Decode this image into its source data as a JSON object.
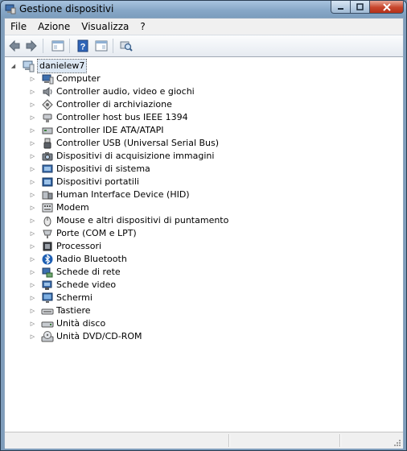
{
  "window": {
    "title": "Gestione dispositivi"
  },
  "menu": [
    "File",
    "Azione",
    "Visualizza",
    "?"
  ],
  "toolbar": {
    "buttons": [
      "back-arrow-icon",
      "forward-arrow-icon",
      "console-tree-icon",
      "help-icon",
      "properties-icon",
      "scan-hardware-icon"
    ]
  },
  "tree": {
    "root": "danielew7",
    "items": [
      {
        "label": "Computer",
        "icon": "computer-icon"
      },
      {
        "label": "Controller audio, video e giochi",
        "icon": "speaker-icon"
      },
      {
        "label": "Controller di archiviazione",
        "icon": "storage-controller-icon"
      },
      {
        "label": "Controller host bus IEEE 1394",
        "icon": "ieee1394-icon"
      },
      {
        "label": "Controller IDE ATA/ATAPI",
        "icon": "ide-controller-icon"
      },
      {
        "label": "Controller USB (Universal Serial Bus)",
        "icon": "usb-icon"
      },
      {
        "label": "Dispositivi di acquisizione immagini",
        "icon": "camera-icon"
      },
      {
        "label": "Dispositivi di sistema",
        "icon": "system-device-icon"
      },
      {
        "label": "Dispositivi portatili",
        "icon": "portable-device-icon"
      },
      {
        "label": "Human Interface Device (HID)",
        "icon": "hid-icon"
      },
      {
        "label": "Modem",
        "icon": "modem-icon"
      },
      {
        "label": "Mouse e altri dispositivi di puntamento",
        "icon": "mouse-icon"
      },
      {
        "label": "Porte (COM e LPT)",
        "icon": "port-icon"
      },
      {
        "label": "Processori",
        "icon": "processor-icon"
      },
      {
        "label": "Radio Bluetooth",
        "icon": "bluetooth-icon"
      },
      {
        "label": "Schede di rete",
        "icon": "network-card-icon"
      },
      {
        "label": "Schede video",
        "icon": "video-card-icon"
      },
      {
        "label": "Schermi",
        "icon": "monitor-icon"
      },
      {
        "label": "Tastiere",
        "icon": "keyboard-icon"
      },
      {
        "label": "Unità disco",
        "icon": "disk-drive-icon"
      },
      {
        "label": "Unità DVD/CD-ROM",
        "icon": "dvd-drive-icon"
      }
    ]
  },
  "colors": {
    "titlebar": "#88a8c8",
    "close_button": "#c7452c",
    "selection": "#dde8f4"
  }
}
